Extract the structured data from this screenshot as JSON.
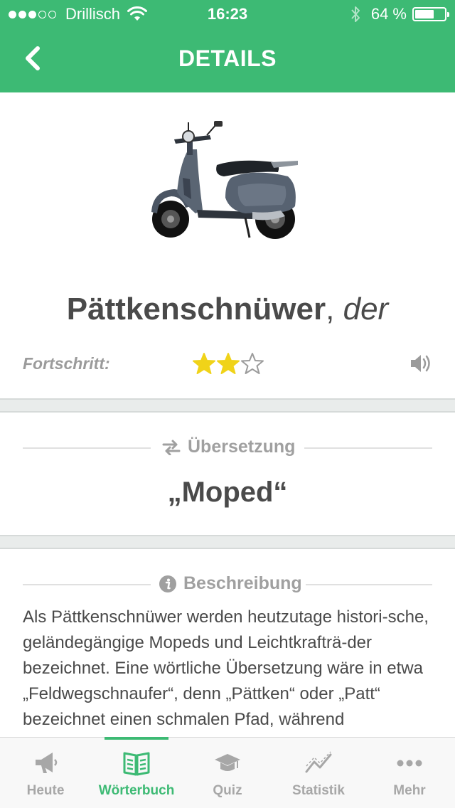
{
  "status_bar": {
    "carrier": "Drillisch",
    "time": "16:23",
    "battery_percent_label": "64 %",
    "battery_level": 0.64,
    "signal_bars_filled": 3,
    "signal_bars_total": 5
  },
  "nav": {
    "title": "DETAILS",
    "back_icon": "chevron-left-icon"
  },
  "entry": {
    "word": "Pättkenschnüwer",
    "comma": ",",
    "article": "der",
    "progress_label": "Fortschritt:",
    "stars_filled": 2,
    "stars_total": 3,
    "image": "scooter-image"
  },
  "translation": {
    "header": "Übersetzung",
    "text": "„Moped“"
  },
  "description": {
    "header": "Beschreibung",
    "text": "Als Pättkenschnüwer werden heutzutage histori-sche, geländegängige Mopeds und Leichtkrafträ-der bezeichnet. Eine wörtliche Übersetzung wäre in etwa „Feldwegschnaufer“, denn „Pättken“ oder „Patt“ bezeichnet einen schmalen Pfad, während"
  },
  "tabs": [
    {
      "label": "Heute",
      "icon": "megaphone-icon",
      "active": false
    },
    {
      "label": "Wörterbuch",
      "icon": "book-icon",
      "active": true
    },
    {
      "label": "Quiz",
      "icon": "graduation-cap-icon",
      "active": false
    },
    {
      "label": "Statistik",
      "icon": "chart-line-icon",
      "active": false
    },
    {
      "label": "Mehr",
      "icon": "more-dots-icon",
      "active": false
    }
  ],
  "colors": {
    "accent": "#3dba74",
    "star_filled": "#f0d319",
    "text": "#4a4a4a",
    "muted": "#a0a0a0"
  }
}
